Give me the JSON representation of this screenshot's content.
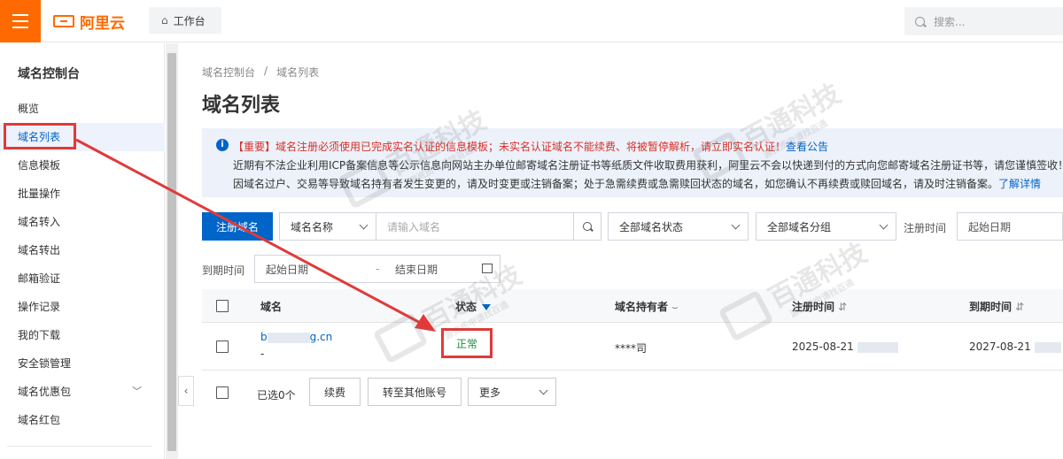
{
  "topbar": {
    "logo_text": "阿里云",
    "workbench_label": "工作台",
    "search_placeholder": "搜索..."
  },
  "sidebar": {
    "title": "域名控制台",
    "items": [
      {
        "label": "概览"
      },
      {
        "label": "域名列表",
        "active": true
      },
      {
        "label": "信息模板"
      },
      {
        "label": "批量操作"
      },
      {
        "label": "域名转入"
      },
      {
        "label": "域名转出"
      },
      {
        "label": "邮箱验证"
      },
      {
        "label": "操作记录"
      },
      {
        "label": "我的下载"
      },
      {
        "label": "安全锁管理"
      },
      {
        "label": "域名优惠包",
        "expandable": true
      },
      {
        "label": "域名红包"
      }
    ]
  },
  "breadcrumb": [
    "域名控制台",
    "/",
    "域名列表"
  ],
  "page_title": "域名列表",
  "notice": {
    "line1_red": "【重要】域名注册必须使用已完成实名认证的信息模板；未实名认证域名不能续费、将被暂停解析，请立即实名认证！",
    "line1_link": "查看公告",
    "line2": "近期有不法企业利用ICP备案信息等公示信息向网站主办单位邮寄域名注册证书等纸质文件收取费用获利，阿里云不会以快递到付的方式向您邮寄域名注册证书等，请您谨慎签收！",
    "line3": "因域名过户、交易等导致域名持有者发生变更的，请及时变更或注销备案；处于急需续费或急需赎回状态的域名，如您确认不再续费或赎回域名，请及时注销备案。",
    "line3_link": "了解详情"
  },
  "filters": {
    "register_button": "注册域名",
    "field_select": "域名名称",
    "domain_input_placeholder": "请输入域名",
    "status_select": "全部域名状态",
    "group_select": "全部域名分组",
    "reg_time_label": "注册时间",
    "reg_start_placeholder": "起始日期",
    "expire_label": "到期时间",
    "expire_start_placeholder": "起始日期",
    "range_sep": "-",
    "expire_end_placeholder": "结束日期"
  },
  "table": {
    "headers": {
      "domain": "域名",
      "status": "状态",
      "holder": "域名持有者",
      "reg_time": "注册时间",
      "expire_time": "到期时间"
    },
    "rows": [
      {
        "domain_prefix": "b",
        "domain_suffix": "g.cn",
        "domain_sub": "-",
        "status": "正常",
        "holder": "****司",
        "reg_time": "2025-08-21",
        "expire_time": "2027-08-21"
      }
    ]
  },
  "footer": {
    "selected": "已选0个",
    "renew_button": "续费",
    "transfer_button": "转至其他账号",
    "more_select": "更多"
  },
  "watermark": {
    "text": "百通科技",
    "sub": "源资质申请找百通"
  },
  "colors": {
    "brand": "#ff6a00",
    "primary": "#0064c8",
    "annotation": "#e03a3a",
    "status_ok": "#1e8e3e"
  }
}
